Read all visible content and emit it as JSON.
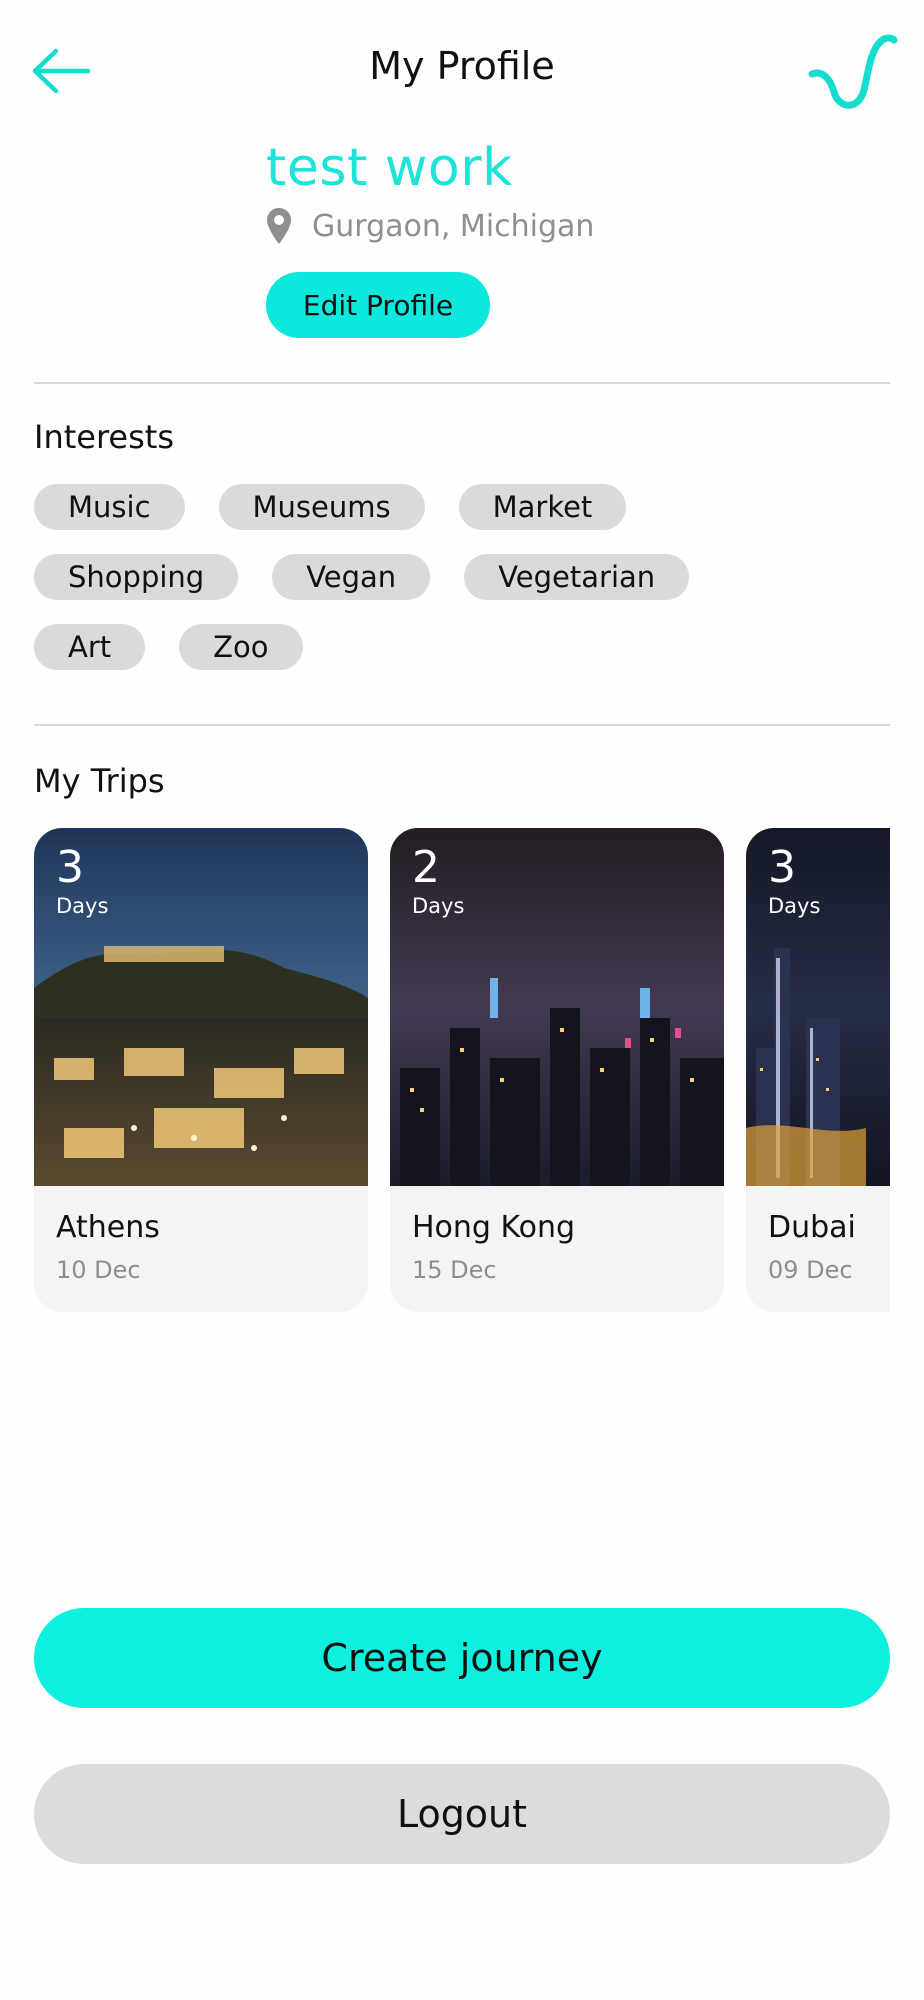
{
  "header": {
    "title": "My Profile",
    "back_icon": "arrow-left-icon",
    "logo_icon": "brand-logo-icon"
  },
  "profile": {
    "name": "test work",
    "location": "Gurgaon, Michigan",
    "location_icon": "map-pin-icon",
    "edit_label": "Edit Profile"
  },
  "interests": {
    "title": "Interests",
    "rows": [
      [
        "Music",
        "Museums",
        "Market"
      ],
      [
        "Shopping",
        "Vegan",
        "Vegetarian"
      ],
      [
        "Art",
        "Zoo"
      ]
    ]
  },
  "trips": {
    "title": "My Trips",
    "days_label": "Days",
    "items": [
      {
        "days": "3",
        "city": "Athens",
        "date": "10 Dec"
      },
      {
        "days": "2",
        "city": "Hong Kong",
        "date": "15 Dec"
      },
      {
        "days": "3",
        "city": "Dubai",
        "date": "09 Dec"
      }
    ]
  },
  "actions": {
    "create_label": "Create journey",
    "logout_label": "Logout"
  },
  "colors": {
    "accent": "#0cf0df",
    "name_text": "#1ee3d8",
    "chip_bg": "#dadada",
    "muted_text": "#8e8e8e"
  }
}
